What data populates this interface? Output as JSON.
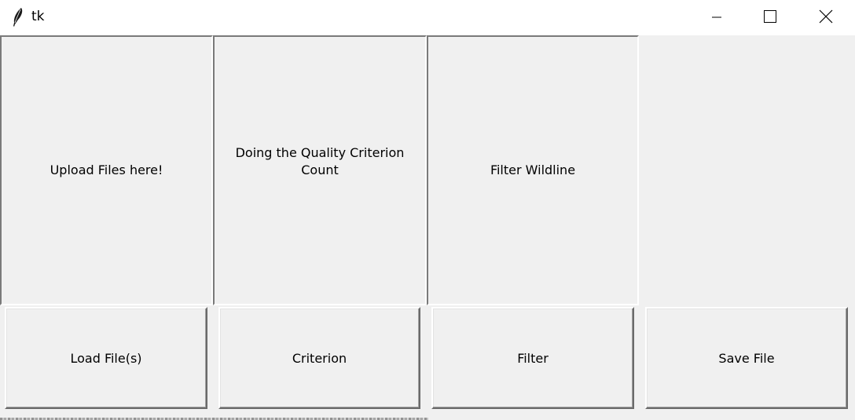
{
  "window": {
    "title": "tk"
  },
  "panels": {
    "upload_label": "Upload Files here!",
    "criterion_label": "Doing the Quality Criterion Count",
    "filter_label": "Filter Wildline",
    "save_label": ""
  },
  "buttons": {
    "load": "Load File(s)",
    "criterion": "Criterion",
    "filter": "Filter",
    "save": "Save File"
  },
  "icons": {
    "app": "feather-icon",
    "minimize": "minimize-icon",
    "maximize": "maximize-icon",
    "close": "close-icon"
  }
}
